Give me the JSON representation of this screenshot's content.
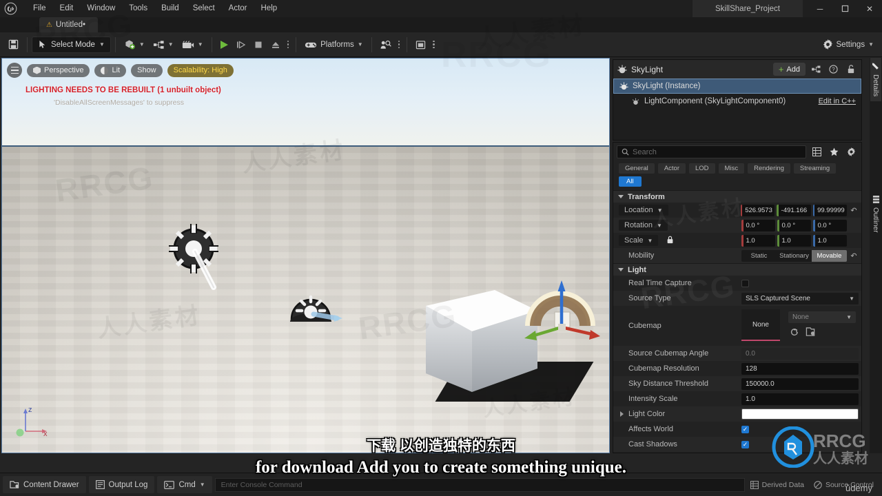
{
  "window": {
    "project_title": "SkillShare_Project",
    "minimize_label": "─",
    "maximize_label": "❐",
    "close_label": "✕"
  },
  "menu": {
    "items": [
      {
        "label": "File"
      },
      {
        "label": "Edit"
      },
      {
        "label": "Window"
      },
      {
        "label": "Tools"
      },
      {
        "label": "Build"
      },
      {
        "label": "Select"
      },
      {
        "label": "Actor"
      },
      {
        "label": "Help"
      }
    ]
  },
  "level_tab": {
    "label": "Untitled•",
    "warning_icon": "⚠"
  },
  "toolbar": {
    "save_icon": "save-icon",
    "mode_label": "Select Mode",
    "add_icon": "add-actor-icon",
    "blueprint_icon": "blueprints-icon",
    "cinematics_icon": "cinematics-icon",
    "play_label": "Play",
    "skip_label": "▷|",
    "stop_label": "■",
    "eject_label": "⏏",
    "platforms_label": "Platforms",
    "settings_label": "Settings"
  },
  "viewport": {
    "perspective_label": "Perspective",
    "lit_label": "Lit",
    "show_label": "Show",
    "scalability_label": "Scalability: High",
    "warning_main": "LIGHTING NEEDS TO BE REBUILT (1 unbuilt object)",
    "warning_sub": "'DisableAllScreenMessages' to suppress",
    "axis_z": "z",
    "axis_x": "x",
    "actors": {
      "skylight": "skylight-actor-icon",
      "directional_light": "directional-light-actor-icon",
      "cube": "static-mesh-cube",
      "gizmo": "translate-gizmo"
    }
  },
  "outliner": {
    "title": "SkyLight",
    "add_label": "Add",
    "icons": [
      "hierarchy-icon",
      "help-icon",
      "lock-icon"
    ],
    "rows": [
      {
        "label": "SkyLight (Instance)",
        "selected": true,
        "action": ""
      },
      {
        "label": "LightComponent (SkyLightComponent0)",
        "selected": false,
        "action": "Edit in C++"
      }
    ]
  },
  "rail": {
    "details_label": "Details",
    "outliner_label": "Outliner"
  },
  "details": {
    "search_placeholder": "Search",
    "search_value": "",
    "filters": [
      "General",
      "Actor",
      "LOD",
      "Misc",
      "Rendering",
      "Streaming"
    ],
    "active_filter": "All",
    "sections": {
      "transform": {
        "title": "Transform",
        "location": {
          "label": "Location",
          "x": "526.9573",
          "y": "-491.166",
          "z": "99.99999"
        },
        "rotation": {
          "label": "Rotation",
          "x": "0.0 °",
          "y": "0.0 °",
          "z": "0.0 °"
        },
        "scale": {
          "label": "Scale",
          "x": "1.0",
          "y": "1.0",
          "z": "1.0",
          "locked": true
        },
        "mobility": {
          "label": "Mobility",
          "options": [
            "Static",
            "Stationary",
            "Movable"
          ],
          "selected": "Movable"
        }
      },
      "light": {
        "title": "Light",
        "rows": [
          {
            "label": "Real Time Capture",
            "type": "checkbox",
            "value": false
          },
          {
            "label": "Source Type",
            "type": "combo",
            "value": "SLS Captured Scene"
          },
          {
            "label": "Cubemap",
            "type": "asset",
            "value": "None",
            "picker_value": "None"
          },
          {
            "label": "Source Cubemap Angle",
            "type": "text",
            "value": "0.0",
            "dim": true
          },
          {
            "label": "Cubemap Resolution",
            "type": "text",
            "value": "128"
          },
          {
            "label": "Sky Distance Threshold",
            "type": "text",
            "value": "150000.0"
          },
          {
            "label": "Intensity Scale",
            "type": "text",
            "value": "1.0"
          },
          {
            "label": "Light Color",
            "type": "color",
            "value": "#ffffff"
          },
          {
            "label": "Affects World",
            "type": "checkbox",
            "value": true
          },
          {
            "label": "Cast Shadows",
            "type": "checkbox",
            "value": true
          }
        ]
      }
    }
  },
  "statusbar": {
    "content_drawer": "Content Drawer",
    "output_log": "Output Log",
    "cmd": "Cmd",
    "console_placeholder": "Enter Console Command",
    "derived_data": "Derived Data",
    "source_control": "Source Control"
  },
  "subtitles": {
    "chinese": "下载 以创造独特的东西",
    "english": "for download Add you to create something unique."
  },
  "watermarks": {
    "brand": "RRCG",
    "cn": "人人素材",
    "udemy": "ŭdemy"
  },
  "colors": {
    "accent_blue": "#1f78d1",
    "selection_blue": "#3e5a78",
    "play_green": "#6dbb3c",
    "scalability_yellow": "#ffd94a",
    "warning_red": "#d4212b",
    "axis_x": "#a33c3c",
    "axis_y": "#5d8c3a",
    "axis_z": "#3a6aa8"
  }
}
